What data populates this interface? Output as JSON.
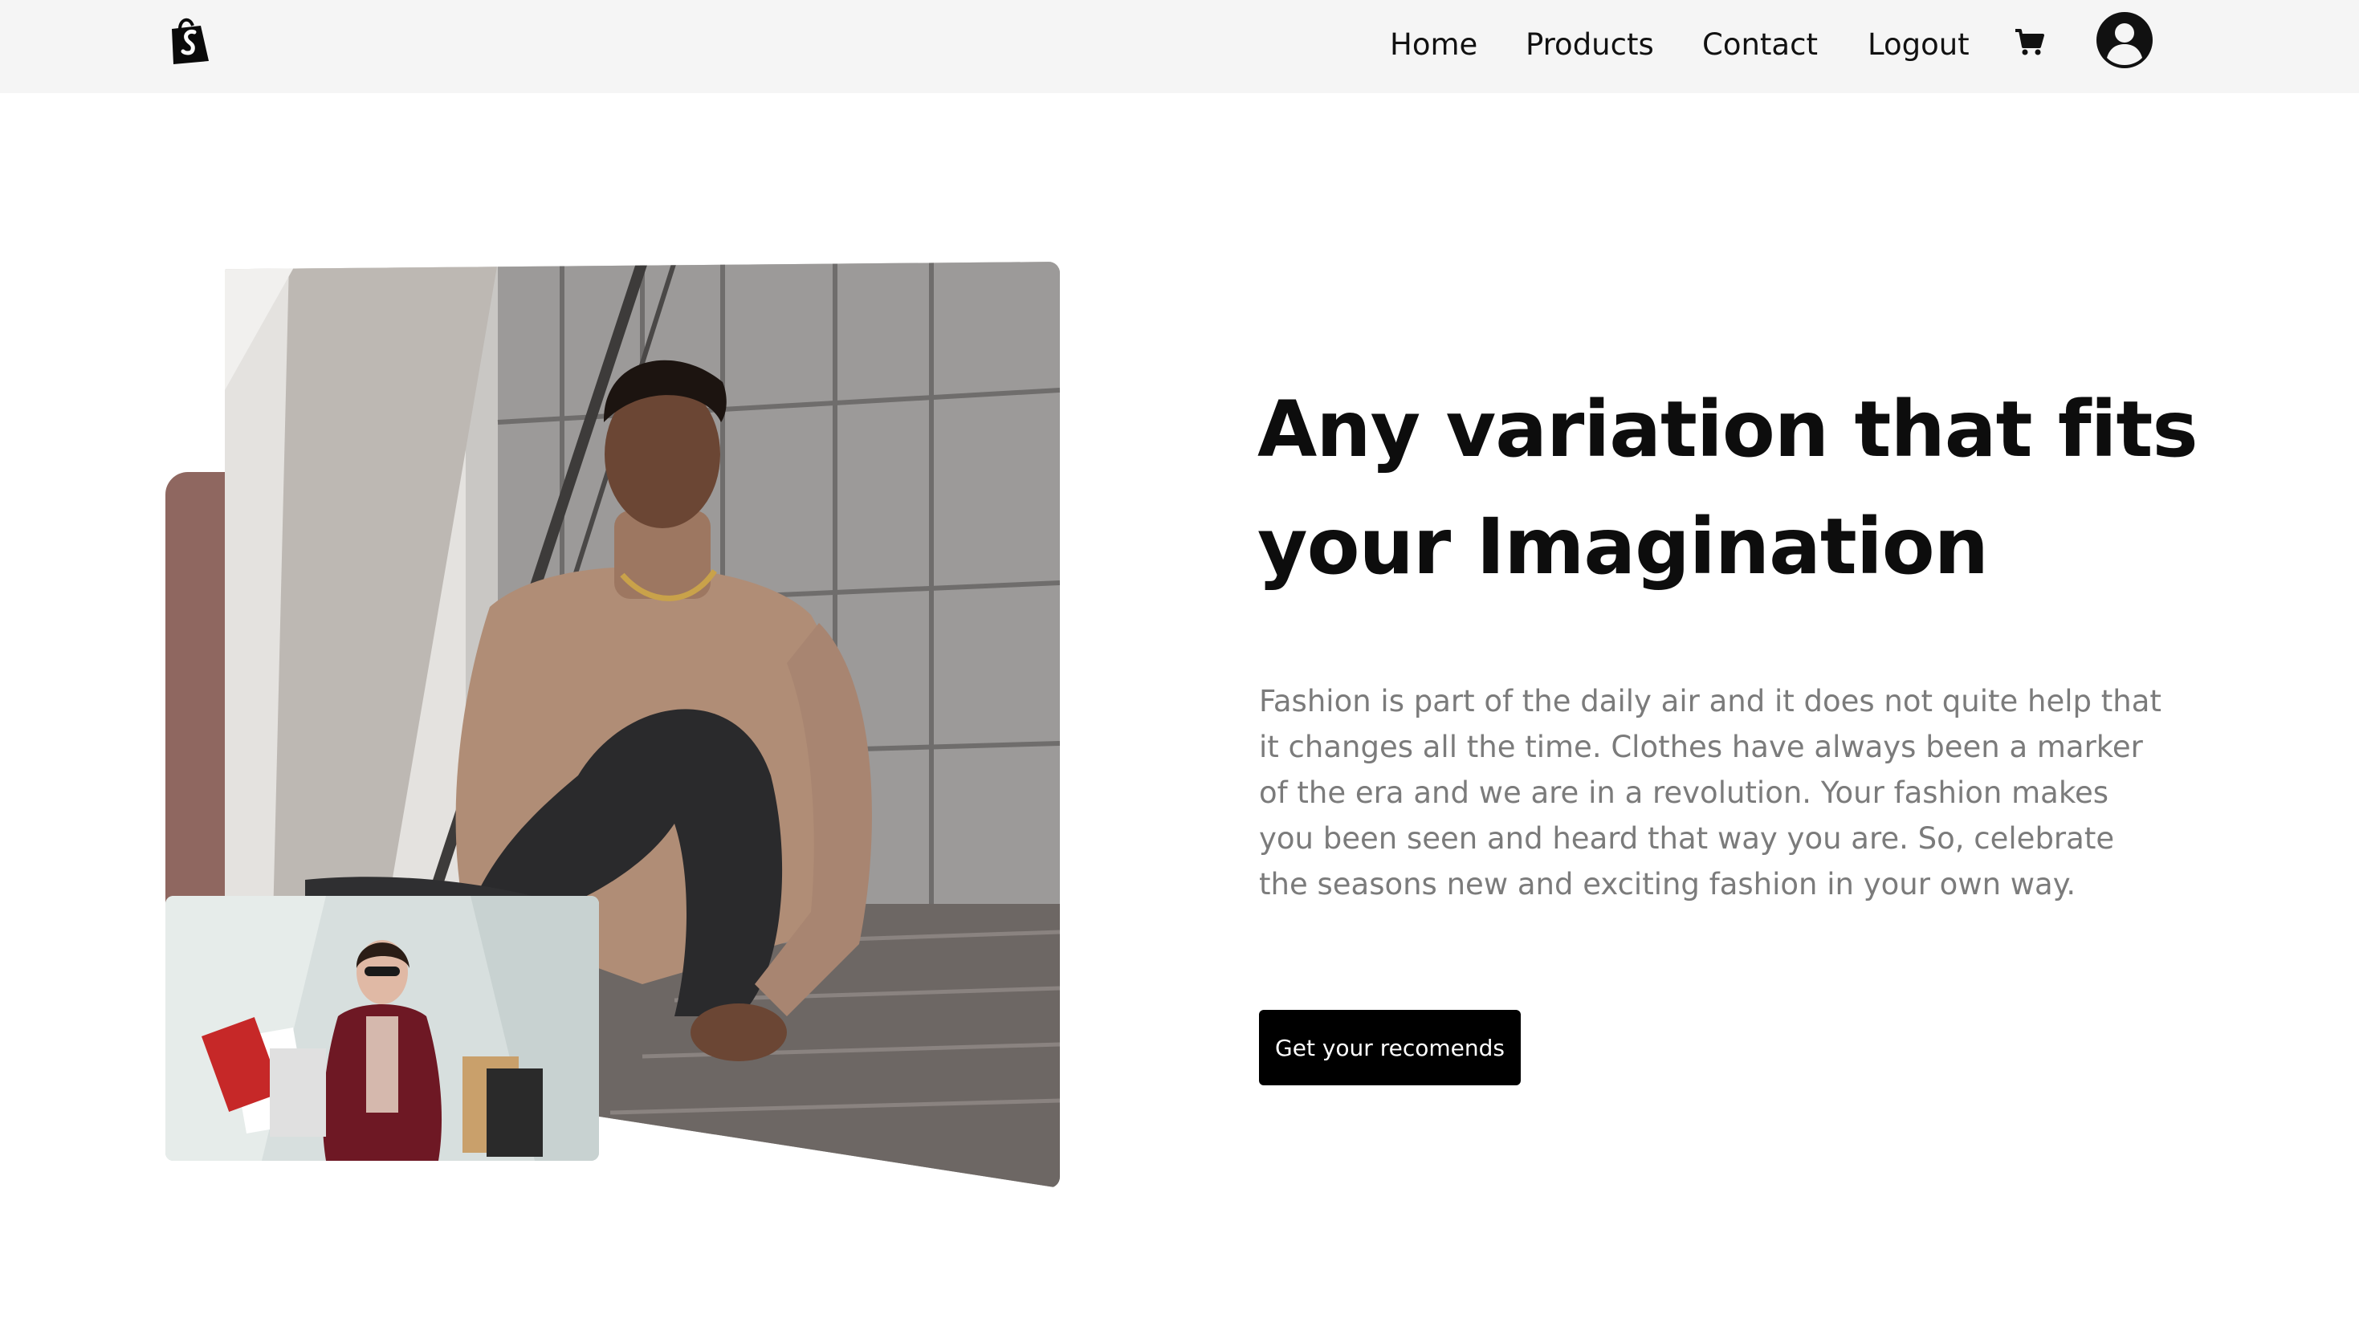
{
  "nav": {
    "logo_icon": "shopping-bag-logo-icon",
    "links": [
      {
        "label": "Home"
      },
      {
        "label": "Products"
      },
      {
        "label": "Contact"
      },
      {
        "label": "Logout"
      }
    ],
    "cart_icon": "cart-icon",
    "account_icon": "user-circle-icon",
    "background": "#f5f5f5"
  },
  "hero": {
    "title_line1": "Any variation that fits",
    "title_line2": "your Imagination",
    "description": "Fashion is part of the daily air and it does not quite help that it changes all the time. Clothes have always been a marker of the era and we are in a revolution. Your fashion makes you been seen and heard that way you are. So, celebrate the seasons new and exciting fashion in your own way.",
    "cta_label": "Get your recomends",
    "accent_color": "#8f6760",
    "main_image": "man-sitting-on-stairs-photo",
    "secondary_image": "woman-with-shopping-bags-photo"
  }
}
